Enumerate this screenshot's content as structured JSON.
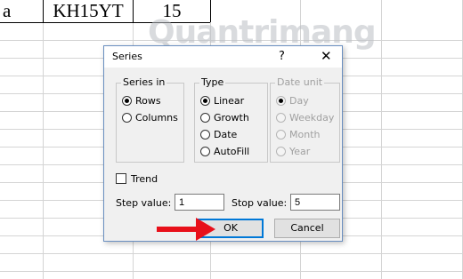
{
  "sheet": {
    "cells": [
      "a",
      "KH15YT",
      "15"
    ],
    "watermark": "Quantrimang"
  },
  "dialog": {
    "title": "Series",
    "help": "?",
    "close": "✕",
    "series_in": {
      "label": "Series in",
      "options": [
        "Rows",
        "Columns"
      ],
      "selected": "Rows"
    },
    "type": {
      "label": "Type",
      "options": [
        "Linear",
        "Growth",
        "Date",
        "AutoFill"
      ],
      "selected": "Linear"
    },
    "date_unit": {
      "label": "Date unit",
      "options": [
        "Day",
        "Weekday",
        "Month",
        "Year"
      ],
      "enabled": false
    },
    "trend": {
      "label": "Trend",
      "checked": false
    },
    "step_value": {
      "label": "Step value:",
      "value": "1"
    },
    "stop_value": {
      "label": "Stop value:",
      "value": "5"
    },
    "ok_label": "OK",
    "cancel_label": "Cancel"
  },
  "colors": {
    "annotation_arrow": "#e8101a",
    "default_button_border": "#0078d7"
  }
}
